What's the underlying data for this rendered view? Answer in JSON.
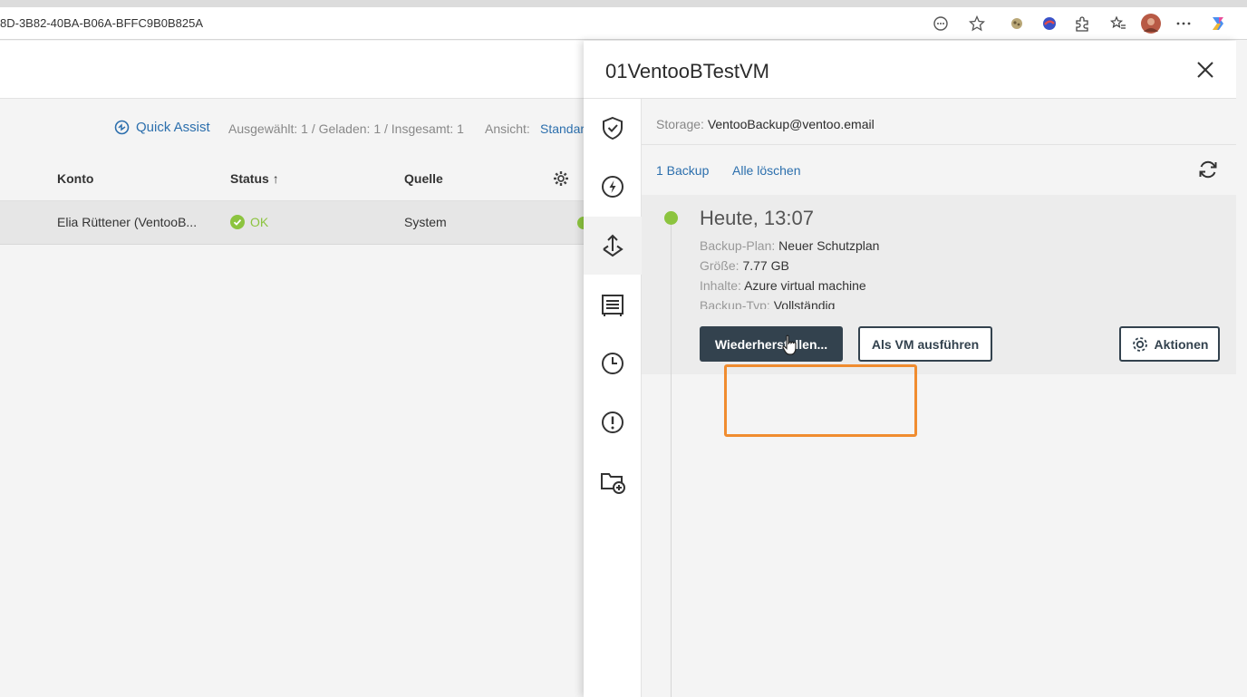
{
  "browser": {
    "url_fragment": "8D-3B82-40BA-B06A-BFFC9B0B825A"
  },
  "toolbar": {
    "quick_assist": "Quick Assist",
    "counts": "Ausgewählt: 1 / Geladen: 1 / Insgesamt: 1",
    "view_label": "Ansicht:",
    "view_value": "Standar"
  },
  "table": {
    "columns": [
      "Konto",
      "Status",
      "Quelle"
    ],
    "sort_arrow": "↑",
    "rows": [
      {
        "konto": "Elia Rüttener (VentooB...",
        "status": "OK",
        "quelle": "System"
      }
    ]
  },
  "panel": {
    "title": "01VentooBTestVM",
    "storage_label": "Storage:",
    "storage_value": "VentooBackup@ventoo.email",
    "backup_count": "1 Backup",
    "delete_all": "Alle löschen",
    "entry": {
      "when": "Heute, 13:07",
      "plan_label": "Backup-Plan:",
      "plan_value": "Neuer Schutzplan",
      "size_label": "Größe:",
      "size_value": "7.77 GB",
      "content_label": "Inhalte:",
      "content_value": "Azure virtual machine",
      "type_label": "Backup-Typ:",
      "type_value": "Vollständig"
    },
    "buttons": {
      "restore": "Wiederherstellen...",
      "run_vm": "Als VM ausführen",
      "actions": "Aktionen"
    }
  },
  "colors": {
    "accent_link": "#2c6fad",
    "ok_green": "#8cc43f",
    "primary_button": "#33424e",
    "highlight": "#f08c2f"
  }
}
